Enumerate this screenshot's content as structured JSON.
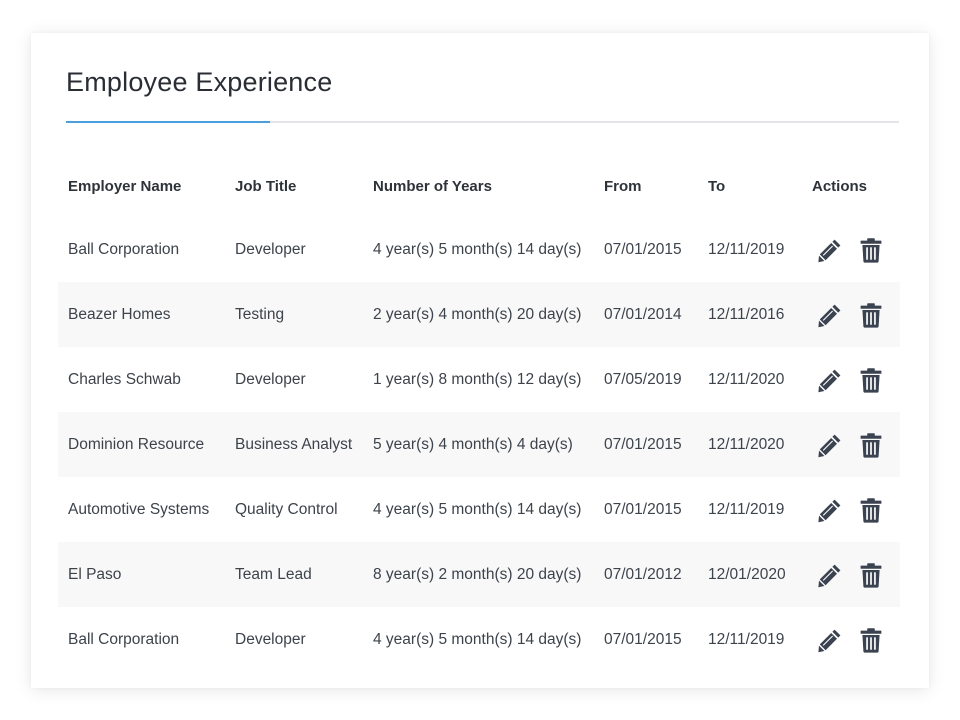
{
  "panel": {
    "title": "Employee Experience"
  },
  "table": {
    "headers": {
      "employer": "Employer Name",
      "job": "Job Title",
      "years": "Number of Years",
      "from": "From",
      "to": "To",
      "actions": "Actions"
    },
    "rows": [
      {
        "employer": "Ball Corporation",
        "job": "Developer",
        "years": "4 year(s) 5 month(s) 14 day(s)",
        "from": "07/01/2015",
        "to": "12/11/2019"
      },
      {
        "employer": "Beazer Homes",
        "job": "Testing",
        "years": "2 year(s) 4 month(s) 20 day(s)",
        "from": "07/01/2014",
        "to": "12/11/2016"
      },
      {
        "employer": "Charles Schwab",
        "job": "Developer",
        "years": "1 year(s) 8 month(s) 12 day(s)",
        "from": "07/05/2019",
        "to": "12/11/2020"
      },
      {
        "employer": "Dominion Resource",
        "job": "Business Analyst",
        "years": "5 year(s) 4 month(s) 4 day(s)",
        "from": "07/01/2015",
        "to": "12/11/2020"
      },
      {
        "employer": "Automotive Systems",
        "job": "Quality Control",
        "years": "4 year(s) 5 month(s) 14 day(s)",
        "from": "07/01/2015",
        "to": "12/11/2019"
      },
      {
        "employer": "El Paso",
        "job": "Team Lead",
        "years": "8 year(s) 2 month(s) 20 day(s)",
        "from": "07/01/2012",
        "to": "12/01/2020"
      },
      {
        "employer": "Ball Corporation",
        "job": "Developer",
        "years": "4 year(s) 5 month(s) 14 day(s)",
        "from": "07/01/2015",
        "to": "12/11/2019"
      }
    ],
    "row_actions": [
      {
        "icon": "pencil-icon",
        "name": "edit"
      },
      {
        "icon": "trash-icon",
        "name": "delete"
      }
    ]
  },
  "colors": {
    "accent": "#4a9fdc",
    "icon": "#3b4250",
    "stripe": "#f8f8f9"
  }
}
